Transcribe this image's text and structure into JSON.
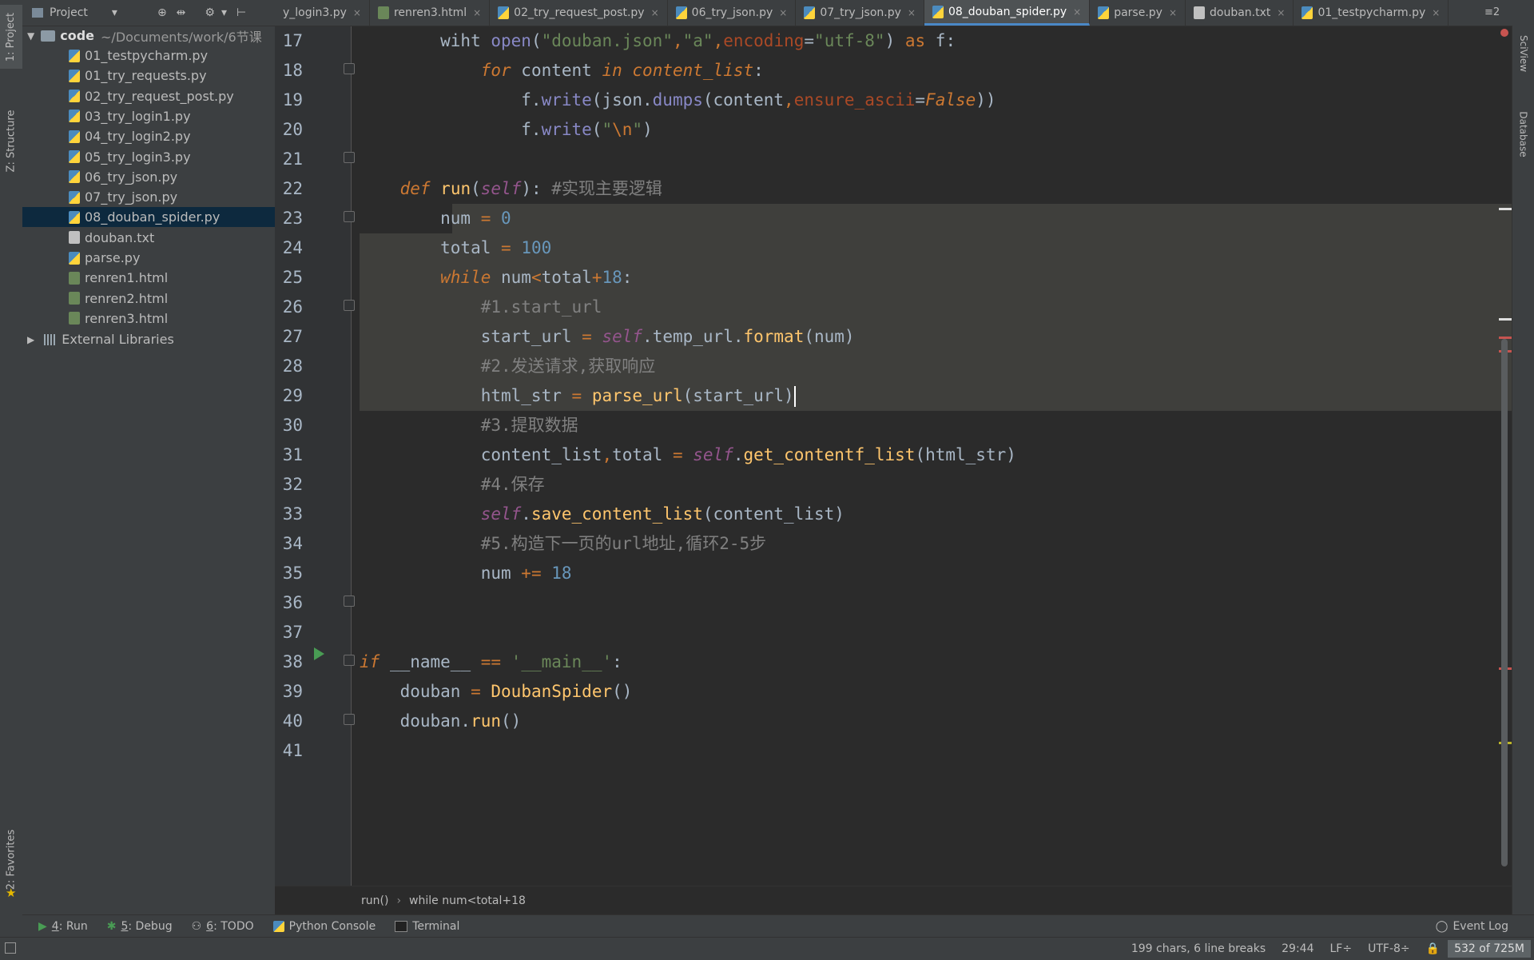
{
  "left_tool_strip": {
    "project_label": "1: Project",
    "structure_label": "Z: Structure",
    "favorites_label": "2: Favorites"
  },
  "right_tool_strip": {
    "sciview_label": "SciView",
    "database_label": "Database"
  },
  "project_panel": {
    "header": "Project",
    "root": {
      "name": "code",
      "path": "~/Documents/work/6节课"
    },
    "files": [
      {
        "name": "01_testpycharm.py",
        "type": "py"
      },
      {
        "name": "01_try_requests.py",
        "type": "py"
      },
      {
        "name": "02_try_request_post.py",
        "type": "py"
      },
      {
        "name": "03_try_login1.py",
        "type": "py"
      },
      {
        "name": "04_try_login2.py",
        "type": "py"
      },
      {
        "name": "05_try_login3.py",
        "type": "py"
      },
      {
        "name": "06_try_json.py",
        "type": "py"
      },
      {
        "name": "07_try_json.py",
        "type": "py"
      },
      {
        "name": "08_douban_spider.py",
        "type": "py",
        "selected": true
      },
      {
        "name": "douban.txt",
        "type": "txt"
      },
      {
        "name": "parse.py",
        "type": "py"
      },
      {
        "name": "renren1.html",
        "type": "html"
      },
      {
        "name": "renren2.html",
        "type": "html"
      },
      {
        "name": "renren3.html",
        "type": "html"
      }
    ],
    "external_libraries": "External Libraries"
  },
  "tabs": [
    {
      "label": "y_login3.py",
      "icon": "py"
    },
    {
      "label": "renren3.html",
      "icon": "html"
    },
    {
      "label": "02_try_request_post.py",
      "icon": "py"
    },
    {
      "label": "06_try_json.py",
      "icon": "py"
    },
    {
      "label": "07_try_json.py",
      "icon": "py"
    },
    {
      "label": "08_douban_spider.py",
      "icon": "py",
      "active": true
    },
    {
      "label": "parse.py",
      "icon": "py"
    },
    {
      "label": "douban.txt",
      "icon": "txt"
    },
    {
      "label": "01_testpycharm.py",
      "icon": "py"
    }
  ],
  "tabs_overflow": "≡2",
  "editor": {
    "line_numbers": [
      "17",
      "18",
      "19",
      "20",
      "21",
      "22",
      "23",
      "24",
      "25",
      "26",
      "27",
      "28",
      "29",
      "30",
      "31",
      "32",
      "33",
      "34",
      "35",
      "36",
      "37",
      "38",
      "39",
      "40",
      "41"
    ]
  },
  "breadcrumb": {
    "items": [
      "run()",
      "while num<total+18"
    ]
  },
  "bottom_tools": [
    {
      "key": "4",
      "label": ": Run"
    },
    {
      "key": "5",
      "label": ": Debug"
    },
    {
      "key": "6",
      "label": ": TODO"
    },
    {
      "key": "",
      "label": "Python Console"
    },
    {
      "key": "",
      "label": "Terminal"
    }
  ],
  "event_log": "Event Log",
  "status": {
    "selection": "199 chars, 6 line breaks",
    "position": "29:44",
    "line_sep": "LF÷",
    "encoding": "UTF-8÷",
    "memory": "532 of 725M"
  },
  "colors": {
    "editor_bg": "#2b2b2b",
    "keyword": "#cc7832",
    "string": "#6a8759",
    "function": "#ffc66d",
    "number": "#6897bb",
    "comment": "#808080",
    "self": "#94558d",
    "selection": "#3f3f3c"
  }
}
